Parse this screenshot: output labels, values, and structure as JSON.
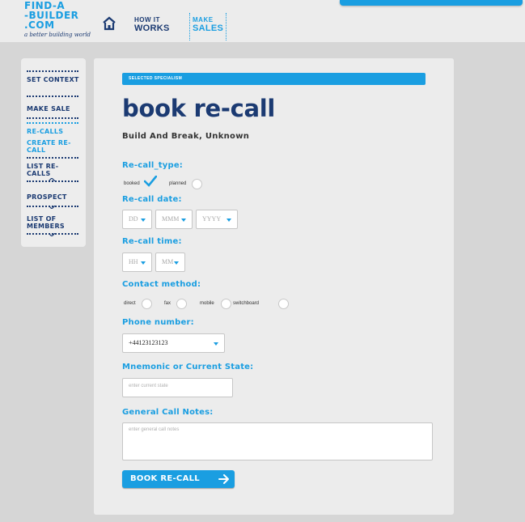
{
  "brand": {
    "logo_line1": "FIND-A",
    "logo_line2": "-BUILDER",
    "logo_line3": ".COM",
    "tagline": "a better building world",
    "color_primary": "#1a9ee1",
    "color_dark": "#1b3a72"
  },
  "header": {
    "nav": [
      {
        "small": "HOW IT",
        "big": "WORKS"
      },
      {
        "small": "MAKE",
        "big": "SALES"
      }
    ]
  },
  "sidebar": {
    "items": [
      {
        "label": "SET CONTEXT"
      },
      {
        "label": "MAKE SALE"
      },
      {
        "label": "RE-CALLS"
      },
      {
        "label": "CREATE RE-CALL"
      },
      {
        "label": "LIST RE-CALLS"
      },
      {
        "label": "PROSPECT"
      },
      {
        "label": "LIST OF MEMBERS"
      }
    ]
  },
  "form": {
    "specialism_label": "SELECTED SPECIALISM",
    "title": "book re-call",
    "company": "Build And Break, Unknown",
    "recall_type": {
      "label": "Re-call_type:",
      "options": [
        {
          "label": "booked",
          "checked": true
        },
        {
          "label": "planned",
          "checked": false
        }
      ]
    },
    "recall_date": {
      "label": "Re-call date:",
      "day": "DD",
      "month": "MMM",
      "year": "YYYY"
    },
    "recall_time": {
      "label": "Re-call time:",
      "hour": "HH",
      "minute": "MM"
    },
    "contact_method": {
      "label": "Contact method:",
      "options": [
        "direct",
        "fax",
        "mobile",
        "switchboard"
      ]
    },
    "phone": {
      "label": "Phone number:",
      "value": "+44123123123"
    },
    "mnemonic": {
      "label": "Mnemonic or Current State:",
      "placeholder": "enter current state"
    },
    "notes": {
      "label": "General Call Notes:",
      "placeholder": "enter general call notes"
    },
    "submit_label": "BOOK RE-CALL"
  }
}
